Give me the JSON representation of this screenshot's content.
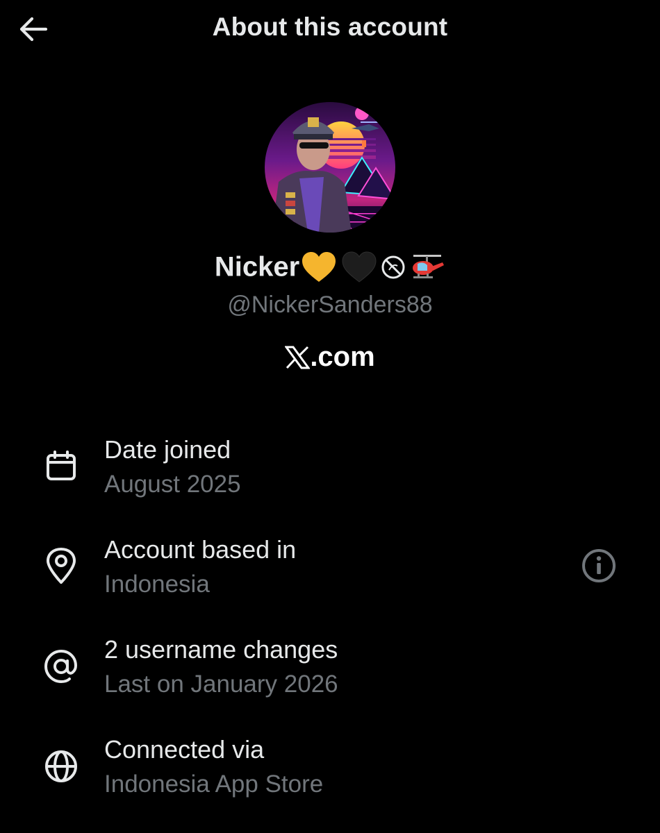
{
  "header": {
    "title": "About this account",
    "back_icon": "arrow-left-icon"
  },
  "profile": {
    "display_name": "Nicker",
    "name_emojis": [
      "yellow-heart-icon",
      "black-heart-icon",
      "prohibited-icon",
      "helicopter-icon"
    ],
    "handle": "@NickerSanders88",
    "platform_icon": "x-logo-icon",
    "platform_label": ".com"
  },
  "details": [
    {
      "icon": "calendar-icon",
      "label": "Date joined",
      "value": "August 2025"
    },
    {
      "icon": "location-pin-icon",
      "label": "Account based in",
      "value": "Indonesia",
      "action_icon": "info-icon"
    },
    {
      "icon": "at-sign-icon",
      "label": "2 username changes",
      "value": "Last on January 2026"
    },
    {
      "icon": "globe-icon",
      "label": "Connected via",
      "value": "Indonesia App Store"
    }
  ],
  "colors": {
    "background": "#000000",
    "primary_text": "#e7e9ea",
    "secondary_text": "#71767b",
    "yellow_heart": "#f5b52e",
    "helicopter": "#e53935"
  }
}
